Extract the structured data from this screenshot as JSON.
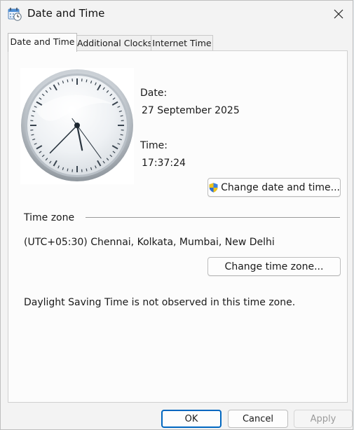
{
  "window": {
    "title": "Date and Time",
    "close_icon": "close-icon",
    "app_icon": "date-time-icon"
  },
  "tabs": [
    {
      "label": "Date and Time",
      "active": true
    },
    {
      "label": "Additional Clocks",
      "active": false
    },
    {
      "label": "Internet Time",
      "active": false
    }
  ],
  "date_section": {
    "date_label": "Date:",
    "date_value": "27 September 2025",
    "time_label": "Time:",
    "time_value": "17:37:24",
    "change_button": "Change date and time...",
    "change_button_icon": "uac-shield-icon"
  },
  "timezone_section": {
    "heading": "Time zone",
    "value": "(UTC+05:30) Chennai, Kolkata, Mumbai, New Delhi",
    "change_button": "Change time zone...",
    "dst_note": "Daylight Saving Time is not observed in this time zone."
  },
  "footer": {
    "ok": "OK",
    "cancel": "Cancel",
    "apply": "Apply"
  },
  "colors": {
    "accent": "#0067c0",
    "dialog_bg": "#f3f3f3",
    "panel_bg": "#fcfcfc",
    "disabled_text": "#9a9a9a"
  }
}
